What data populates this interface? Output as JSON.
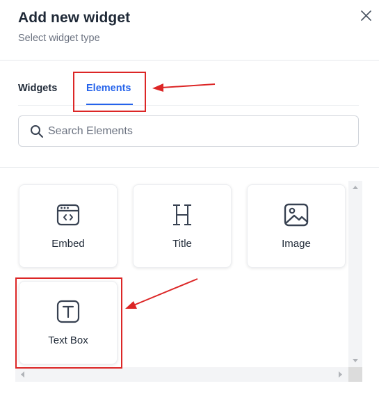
{
  "dialog": {
    "title": "Add new widget",
    "subtitle": "Select widget type"
  },
  "tabs": [
    {
      "label": "Widgets",
      "active": false
    },
    {
      "label": "Elements",
      "active": true
    }
  ],
  "search": {
    "placeholder": "Search Elements",
    "value": ""
  },
  "elements": [
    {
      "label": "Embed",
      "icon": "embed-icon"
    },
    {
      "label": "Title",
      "icon": "heading-icon"
    },
    {
      "label": "Image",
      "icon": "image-icon"
    },
    {
      "label": "Text Box",
      "icon": "text-box-icon"
    }
  ],
  "colors": {
    "accent": "#2563eb",
    "annotation": "#dc2626",
    "text": "#1f2937",
    "muted": "#6b7280",
    "icon": "#374151"
  }
}
